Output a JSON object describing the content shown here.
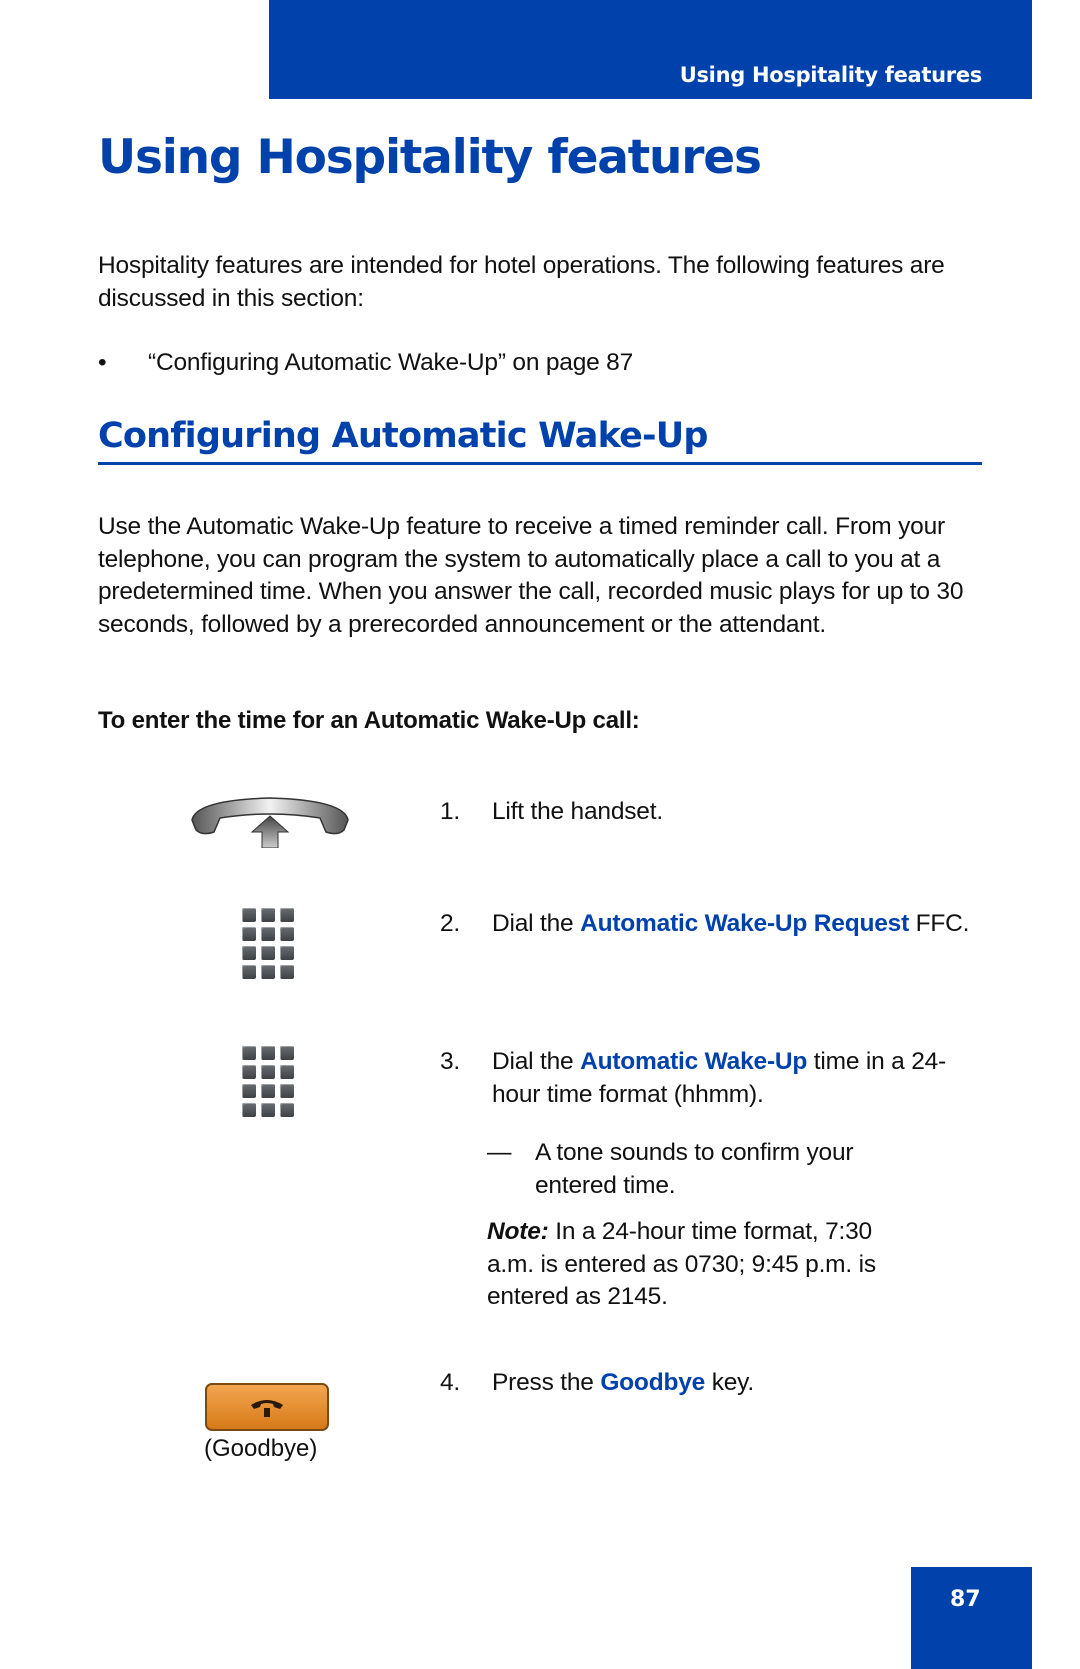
{
  "header": {
    "running_title": "Using Hospitality features"
  },
  "page_title": "Using Hospitality features",
  "intro": {
    "text": "Hospitality features are intended for hotel operations. The following features are discussed in this section:",
    "bullets": [
      {
        "marker": "•",
        "text": "“Configuring Automatic Wake-Up” on page 87"
      }
    ]
  },
  "section": {
    "heading": "Configuring Automatic Wake-Up",
    "description": "Use the Automatic Wake-Up feature to receive a timed reminder call. From your telephone, you can program the system to automatically place a call to you at a predetermined time. When you answer the call, recorded music plays for up to 30 seconds, followed by a prerecorded announcement or the attendant.",
    "procedure_heading": "To enter the time for an Automatic Wake-Up call:"
  },
  "steps": [
    {
      "num": "1.",
      "pre": "Lift the handset.",
      "highlight": "",
      "post": "",
      "icon": "handset-lift-icon"
    },
    {
      "num": "2.",
      "pre": "Dial the ",
      "highlight": "Automatic Wake-Up Request",
      "post": " FFC.",
      "icon": "dialpad-icon"
    },
    {
      "num": "3.",
      "pre": "Dial the ",
      "highlight": "Automatic Wake-Up",
      "post": " time in a 24-hour time format (hhmm).",
      "icon": "dialpad-icon"
    },
    {
      "num": "4.",
      "pre": "Press the ",
      "highlight": "Goodbye",
      "post": " key.",
      "icon": "goodbye-key-icon"
    }
  ],
  "step3_sub": {
    "dash": "—",
    "text": "A tone sounds to confirm your entered time."
  },
  "note": {
    "label": "Note:",
    "text": " In a 24-hour time format, 7:30 a.m. is entered as 0730; 9:45 p.m. is entered as 2145."
  },
  "goodbye_caption": "(Goodbye)",
  "page_number": "87",
  "colors": {
    "brand_blue": "#0041ab",
    "goodbye_orange": "#e8902e"
  }
}
